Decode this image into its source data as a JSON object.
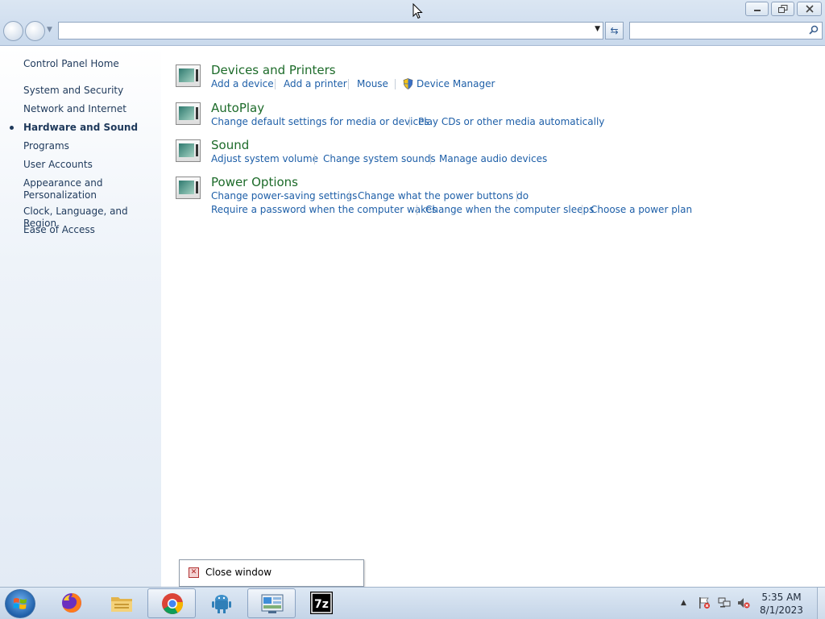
{
  "window": {
    "address_value": "",
    "search_placeholder": ""
  },
  "leftnav": {
    "home": "Control Panel Home",
    "items": [
      {
        "label": "System and Security"
      },
      {
        "label": "Network and Internet"
      },
      {
        "label": "Hardware and Sound",
        "current": true
      },
      {
        "label": "Programs"
      },
      {
        "label": "User Accounts"
      },
      {
        "label": "Appearance and\nPersonalization"
      },
      {
        "label": "Clock, Language, and Region"
      },
      {
        "label": "Ease of Access"
      }
    ]
  },
  "categories": [
    {
      "title": "Devices and Printers",
      "links": [
        "Add a device",
        "Add a printer",
        "Mouse",
        "Device Manager"
      ]
    },
    {
      "title": "AutoPlay",
      "links": [
        "Change default settings for media or devices",
        "Play CDs or other media automatically"
      ]
    },
    {
      "title": "Sound",
      "links": [
        "Adjust system volume",
        "Change system sounds",
        "Manage audio devices"
      ]
    },
    {
      "title": "Power Options",
      "links": [
        "Change power-saving settings",
        "Change what the power buttons do",
        "Require a password when the computer wakes",
        "Change when the computer sleeps",
        "Choose a power plan"
      ]
    }
  ],
  "jumplist": {
    "close_label": "Close window"
  },
  "taskbar": {
    "apps": [
      "firefox-icon",
      "file-explorer-icon",
      "chrome-icon",
      "android-icon",
      "control-panel-icon",
      "7zip-icon"
    ],
    "sevenzip_label": "7z",
    "clock_time": "5:35 AM",
    "clock_date": "8/1/2023"
  },
  "colors": {
    "link": "#1e5fa8",
    "category_title": "#1d6b2a",
    "nav_text": "#1e395b"
  }
}
